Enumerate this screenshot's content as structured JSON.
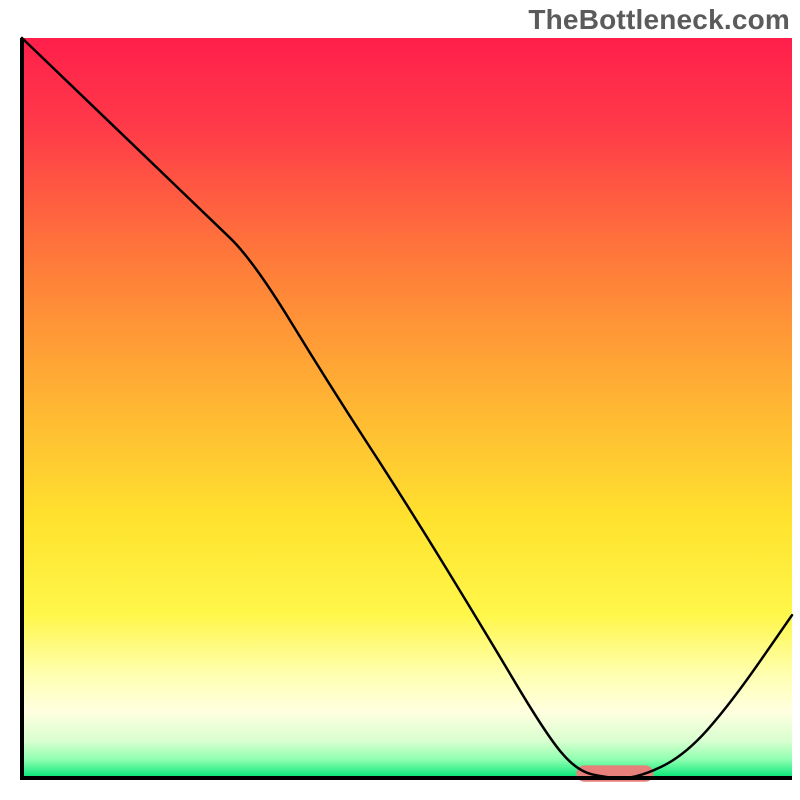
{
  "watermark": "TheBottleneck.com",
  "chart_data": {
    "type": "line",
    "title": "",
    "xlabel": "",
    "ylabel": "",
    "xlim": [
      0,
      100
    ],
    "ylim": [
      0,
      100
    ],
    "grid": false,
    "legend": null,
    "background": {
      "kind": "vertical-gradient",
      "stops": [
        {
          "pos": 0.0,
          "color": "#ff1f4b"
        },
        {
          "pos": 0.12,
          "color": "#ff3a49"
        },
        {
          "pos": 0.3,
          "color": "#ff7a3a"
        },
        {
          "pos": 0.5,
          "color": "#ffb733"
        },
        {
          "pos": 0.65,
          "color": "#ffe22e"
        },
        {
          "pos": 0.78,
          "color": "#fff74a"
        },
        {
          "pos": 0.86,
          "color": "#ffffb0"
        },
        {
          "pos": 0.91,
          "color": "#ffffe0"
        },
        {
          "pos": 0.95,
          "color": "#d9ffd0"
        },
        {
          "pos": 0.975,
          "color": "#8fffb0"
        },
        {
          "pos": 1.0,
          "color": "#00e676"
        }
      ]
    },
    "series": [
      {
        "name": "curve",
        "color": "#000000",
        "width": 2.5,
        "x": [
          0,
          8,
          16,
          24,
          30,
          40,
          50,
          60,
          68,
          72,
          76,
          80,
          86,
          92,
          100
        ],
        "values": [
          100,
          92,
          84,
          76,
          70,
          53,
          37,
          20,
          6,
          1,
          0,
          0,
          3,
          10,
          22
        ]
      }
    ],
    "marker": {
      "name": "optimal-band",
      "shape": "rounded-rect",
      "color": "#e77f7a",
      "x_center": 77,
      "y_center": 0.6,
      "width": 10,
      "height": 2.2,
      "corner_radius": 1.1
    },
    "frame": {
      "show_top": false,
      "show_right": false,
      "show_left": true,
      "show_bottom": true,
      "color": "#000000",
      "width": 4
    }
  }
}
